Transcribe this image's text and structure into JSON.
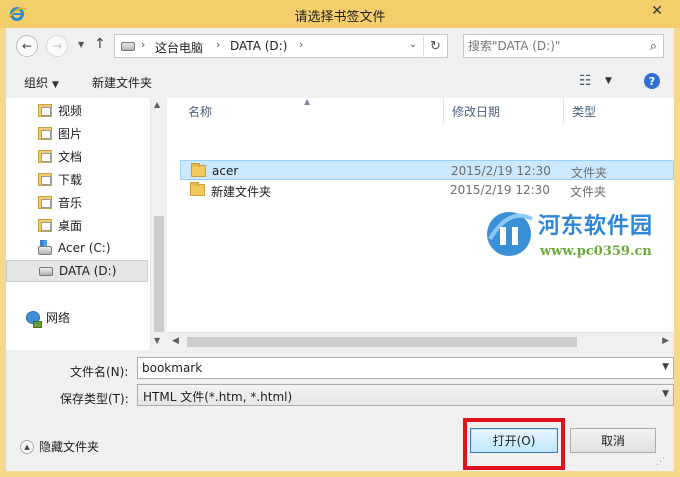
{
  "window": {
    "title": "请选择书签文件",
    "app_icon": "internet-explorer-icon",
    "close_icon": "close-icon"
  },
  "nav": {
    "back_icon": "back-arrow-icon",
    "forward_icon": "forward-arrow-icon",
    "recent_icon": "chevron-down-icon",
    "up_icon": "up-arrow-icon",
    "refresh_icon": "refresh-icon"
  },
  "address": {
    "segments": [
      "这台电脑",
      "DATA (D:)"
    ],
    "drive_icon": "drive-icon"
  },
  "search": {
    "placeholder": "搜索\"DATA (D:)\"",
    "icon": "search-icon"
  },
  "toolbar": {
    "organize_label": "组织",
    "new_folder_label": "新建文件夹",
    "view_icon": "view-details-icon",
    "help_icon": "help-icon"
  },
  "sidebar": {
    "items": [
      {
        "label": "视频",
        "icon": "videos-folder-icon",
        "selected": false
      },
      {
        "label": "图片",
        "icon": "pictures-folder-icon",
        "selected": false
      },
      {
        "label": "文档",
        "icon": "documents-folder-icon",
        "selected": false
      },
      {
        "label": "下载",
        "icon": "downloads-folder-icon",
        "selected": false
      },
      {
        "label": "音乐",
        "icon": "music-folder-icon",
        "selected": false
      },
      {
        "label": "桌面",
        "icon": "desktop-folder-icon",
        "selected": false
      },
      {
        "label": "Acer (C:)",
        "icon": "windows-drive-icon",
        "selected": false
      },
      {
        "label": "DATA (D:)",
        "icon": "drive-icon",
        "selected": true
      },
      {
        "label": "网络",
        "icon": "network-icon",
        "selected": false
      }
    ]
  },
  "file_list": {
    "columns": [
      "名称",
      "修改日期",
      "类型"
    ],
    "rows": [
      {
        "name": "acer",
        "date": "2015/2/19 12:30",
        "type": "文件夹",
        "selected": true
      },
      {
        "name": "新建文件夹",
        "date": "2015/2/19 12:30",
        "type": "文件夹",
        "selected": false
      }
    ]
  },
  "footer": {
    "filename_label": "文件名(N):",
    "filename_value": "bookmark",
    "filetype_label": "保存类型(T):",
    "filetype_value": "HTML 文件(*.htm, *.html)",
    "hide_folders_label": "隐藏文件夹",
    "open_label": "打开(O)",
    "cancel_label": "取消"
  },
  "watermark": {
    "title": "河东软件园",
    "url": "www.pc0359.cn"
  },
  "colors": {
    "title_bar": "#f3ce6a",
    "highlight_box": "#e0121b",
    "selection": "#cce8ff"
  }
}
